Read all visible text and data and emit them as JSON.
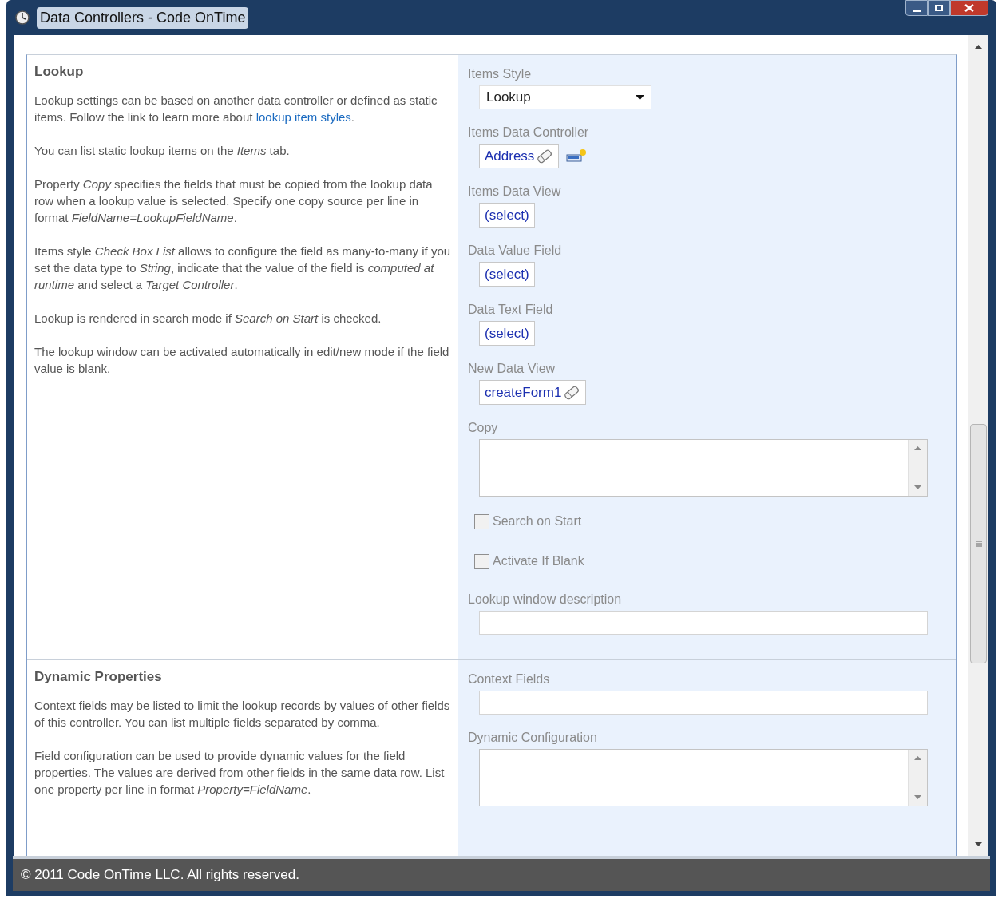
{
  "window": {
    "title": "Data Controllers - Code OnTime"
  },
  "sections": [
    {
      "title": "Lookup",
      "paragraphs": [
        {
          "text": "Lookup settings can be based on another data controller or defined as static items. Follow the link to learn more about",
          "link": "lookup item styles",
          "after": "."
        },
        {
          "text": "You can list static lookup items on the *Items* tab."
        },
        {
          "text": "Property *Copy* specifies the fields that must be copied from the lookup data row when a lookup value is selected. Specify one copy source per line in format *FieldName=LookupFieldName*."
        },
        {
          "text": "Items style *Check Box List* allows to configure the field as many-to-many if you set the data type to *String*, indicate that the value of the field is *computed at runtime* and select a *Target Controller*."
        },
        {
          "text": "Lookup is rendered in search mode if *Search on Start* is checked."
        },
        {
          "text": "The lookup window can be activated automatically in edit/new mode if the field value is blank."
        }
      ],
      "fields": [
        {
          "kind": "dropdown",
          "label": "Items Style",
          "value": "Lookup"
        },
        {
          "kind": "picker_with_new",
          "label": "Items Data Controller",
          "value": "Address",
          "eraser": true
        },
        {
          "kind": "picker",
          "label": "Items Data View",
          "value": "(select)",
          "eraser": false
        },
        {
          "kind": "picker",
          "label": "Data Value Field",
          "value": "(select)",
          "eraser": false
        },
        {
          "kind": "picker",
          "label": "Data Text Field",
          "value": "(select)",
          "eraser": false
        },
        {
          "kind": "picker",
          "label": "New Data View",
          "value": "createForm1",
          "eraser": true
        },
        {
          "kind": "textarea",
          "label": "Copy"
        },
        {
          "kind": "checkbox",
          "label": "Search on Start",
          "checked": false
        },
        {
          "kind": "checkbox",
          "label": "Activate If Blank",
          "checked": false
        },
        {
          "kind": "text",
          "label": "Lookup window description"
        }
      ]
    },
    {
      "title": "Dynamic Properties",
      "paragraphs": [
        {
          "text": "Context fields may be listed to limit the lookup records by values of other fields of this controller. You can list multiple fields separated by comma."
        },
        {
          "text": "Field configuration can be used to provide dynamic values for the field properties. The values are derived from other fields in the same data row. List one property per line in format *Property=FieldName*."
        }
      ],
      "fields": [
        {
          "kind": "text",
          "label": "Context Fields"
        },
        {
          "kind": "textarea",
          "label": "Dynamic Configuration"
        }
      ]
    }
  ],
  "status_bar": {
    "text": "© 2011 Code OnTime LLC. All rights reserved."
  }
}
